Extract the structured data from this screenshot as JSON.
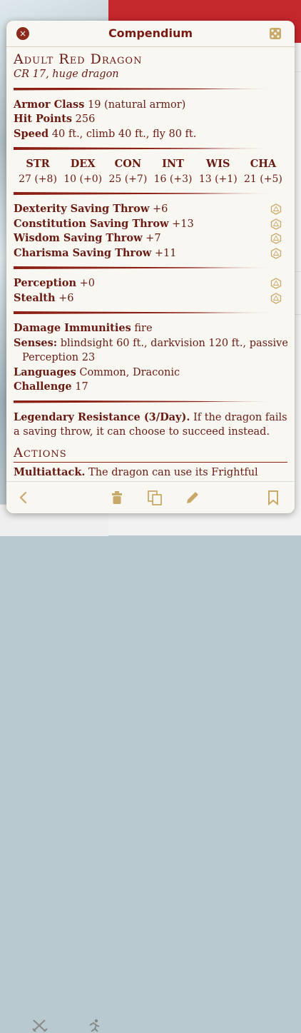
{
  "window": {
    "title": "Compendium"
  },
  "monster": {
    "name": "Adult Red Dragon",
    "subtitle": "CR 17, huge dragon",
    "armor_class": {
      "label": "Armor Class",
      "value": "19 (natural armor)"
    },
    "hit_points": {
      "label": "Hit Points",
      "value": "256"
    },
    "speed": {
      "label": "Speed",
      "value": "40 ft., climb 40 ft., fly 80 ft."
    },
    "abilities": [
      {
        "name": "STR",
        "score": "27 (+8)"
      },
      {
        "name": "DEX",
        "score": "10 (+0)"
      },
      {
        "name": "CON",
        "score": "25 (+7)"
      },
      {
        "name": "INT",
        "score": "16 (+3)"
      },
      {
        "name": "WIS",
        "score": "13 (+1)"
      },
      {
        "name": "CHA",
        "score": "21 (+5)"
      }
    ],
    "saving_throws": [
      {
        "label": "Dexterity Saving Throw",
        "value": "+6"
      },
      {
        "label": "Constitution Saving Throw",
        "value": "+13"
      },
      {
        "label": "Wisdom Saving Throw",
        "value": "+7"
      },
      {
        "label": "Charisma Saving Throw",
        "value": "+11"
      }
    ],
    "skills": [
      {
        "label": "Perception",
        "value": "+0"
      },
      {
        "label": "Stealth",
        "value": "+6"
      }
    ],
    "damage_immunities": {
      "label": "Damage Immunities",
      "value": "fire"
    },
    "senses": {
      "label": "Senses:",
      "value": "blindsight 60 ft., darkvision 120 ft., passive",
      "cont": "Perception 23"
    },
    "languages": {
      "label": "Languages",
      "value": "Common, Draconic"
    },
    "challenge": {
      "label": "Challenge",
      "value": "17"
    },
    "traits": [
      {
        "name": "Legendary Resistance (3/Day).",
        "text": "If the dragon fails a saving throw, it can choose to succeed instead."
      }
    ],
    "actions_title": "Actions",
    "actions": [
      {
        "name": "Multiattack.",
        "text": "The dragon can use its Frightful Presence. It then makes three attacks: one with its bite"
      }
    ]
  },
  "icons": {
    "close": "×",
    "accent": "#7a1a10",
    "d20_color": "#c9a96a"
  }
}
